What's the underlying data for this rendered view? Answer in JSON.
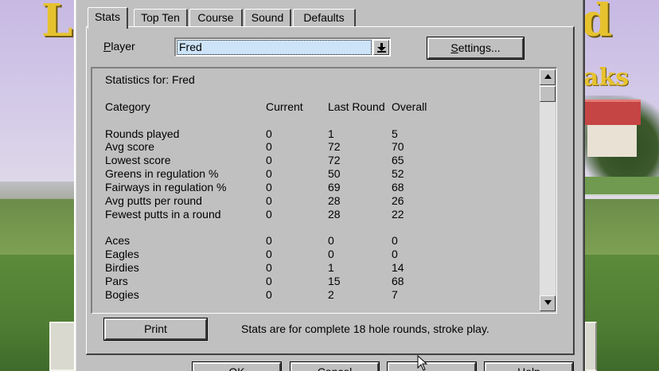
{
  "tabs": [
    {
      "label": "Stats",
      "active": true
    },
    {
      "label": "Top Ten",
      "active": false
    },
    {
      "label": "Course",
      "active": false
    },
    {
      "label": "Sound",
      "active": false
    },
    {
      "label": "Defaults",
      "active": false
    }
  ],
  "player": {
    "label_first": "P",
    "label_rest": "layer",
    "selected": "Fred"
  },
  "settings_button": {
    "underlined": "S",
    "rest": "ettings..."
  },
  "stats": {
    "title": "Statistics for: Fred",
    "columns": {
      "category": "Category",
      "current": "Current",
      "last_round": "Last Round",
      "overall": "Overall"
    },
    "group1": [
      {
        "category": "Rounds played",
        "current": "0",
        "last_round": "1",
        "overall": "5"
      },
      {
        "category": "Avg score",
        "current": "0",
        "last_round": "72",
        "overall": "70"
      },
      {
        "category": "Lowest score",
        "current": "0",
        "last_round": "72",
        "overall": "65"
      },
      {
        "category": "Greens in regulation %",
        "current": "0",
        "last_round": "50",
        "overall": "52"
      },
      {
        "category": "Fairways in regulation %",
        "current": "0",
        "last_round": "69",
        "overall": "68"
      },
      {
        "category": "Avg putts per round",
        "current": "0",
        "last_round": "28",
        "overall": "26"
      },
      {
        "category": "Fewest putts in a round",
        "current": "0",
        "last_round": "28",
        "overall": "22"
      }
    ],
    "group2": [
      {
        "category": "Aces",
        "current": "0",
        "last_round": "0",
        "overall": "0"
      },
      {
        "category": "Eagles",
        "current": "0",
        "last_round": "0",
        "overall": "0"
      },
      {
        "category": "Birdies",
        "current": "0",
        "last_round": "1",
        "overall": "14"
      },
      {
        "category": "Pars",
        "current": "0",
        "last_round": "15",
        "overall": "68"
      },
      {
        "category": "Bogies",
        "current": "0",
        "last_round": "2",
        "overall": "7"
      }
    ]
  },
  "print_button": "Print",
  "footer_note": "Stats are for complete 18 hole rounds, stroke play.",
  "bottom_buttons": [
    "OK",
    "Cancel",
    "",
    "Help"
  ]
}
